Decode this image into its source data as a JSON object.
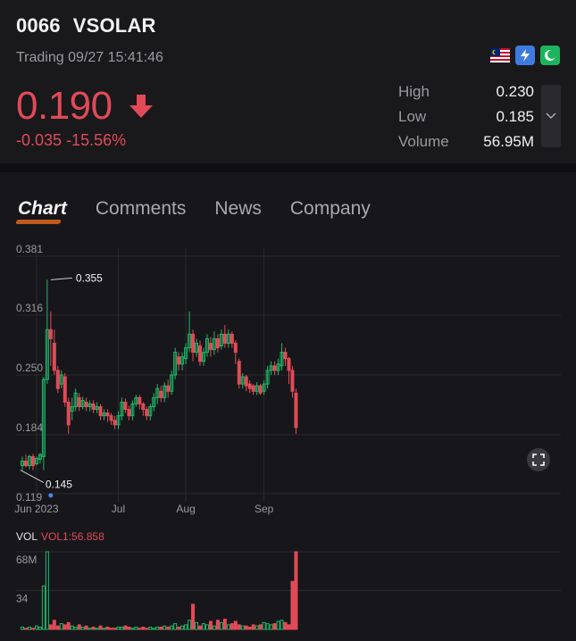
{
  "stock": {
    "code": "0066",
    "name": "VSOLAR"
  },
  "status": "Trading 09/27 15:41:46",
  "market_badges": [
    {
      "name": "malaysia-flag-icon",
      "color": "#c8102e"
    },
    {
      "name": "lightning-badge-icon",
      "color": "#3e7be0"
    },
    {
      "name": "shariah-crescent-icon",
      "color": "#1bb55c"
    }
  ],
  "price": {
    "last": "0.190",
    "change": "-0.035",
    "change_pct": "-15.56%",
    "direction": "down"
  },
  "stats": [
    {
      "label": "High",
      "value": "0.230"
    },
    {
      "label": "Low",
      "value": "0.185"
    },
    {
      "label": "Volume",
      "value": "56.95M"
    }
  ],
  "tabs": [
    {
      "label": "Chart",
      "active": true
    },
    {
      "label": "Comments",
      "active": false
    },
    {
      "label": "News",
      "active": false
    },
    {
      "label": "Company",
      "active": false
    }
  ],
  "colors": {
    "up": "#1fb86a",
    "down": "#e24a57",
    "grid": "#2a2a2e",
    "bg": "#17171b"
  },
  "volume": {
    "label": "VOL",
    "value_label": "VOL1:56.858"
  },
  "chart_data": {
    "type": "candlestick",
    "y_ticks": [
      "0.381",
      "0.316",
      "0.250",
      "0.184",
      "0.119"
    ],
    "ylim": [
      0.119,
      0.381
    ],
    "x_ticks": [
      {
        "label": "Jun 2023",
        "index": 4
      },
      {
        "label": "Jul",
        "index": 27
      },
      {
        "label": "Aug",
        "index": 46
      },
      {
        "label": "Sep",
        "index": 68
      }
    ],
    "annotations": [
      {
        "label": "0.355",
        "index": 8,
        "value": 0.355
      },
      {
        "label": "0.145",
        "index": 6,
        "value": 0.145
      }
    ],
    "candles": [
      [
        0.15,
        0.155,
        0.145,
        0.16
      ],
      [
        0.155,
        0.15,
        0.148,
        0.162
      ],
      [
        0.15,
        0.16,
        0.146,
        0.162
      ],
      [
        0.16,
        0.15,
        0.145,
        0.163
      ],
      [
        0.152,
        0.158,
        0.15,
        0.16
      ],
      [
        0.157,
        0.162,
        0.152,
        0.164
      ],
      [
        0.16,
        0.245,
        0.145,
        0.248
      ],
      [
        0.245,
        0.3,
        0.24,
        0.355
      ],
      [
        0.3,
        0.29,
        0.26,
        0.32
      ],
      [
        0.285,
        0.255,
        0.25,
        0.3
      ],
      [
        0.255,
        0.235,
        0.23,
        0.26
      ],
      [
        0.24,
        0.25,
        0.235,
        0.255
      ],
      [
        0.248,
        0.22,
        0.215,
        0.252
      ],
      [
        0.22,
        0.195,
        0.185,
        0.225
      ],
      [
        0.21,
        0.215,
        0.2,
        0.225
      ],
      [
        0.215,
        0.23,
        0.21,
        0.235
      ],
      [
        0.225,
        0.215,
        0.21,
        0.23
      ],
      [
        0.215,
        0.222,
        0.212,
        0.226
      ],
      [
        0.22,
        0.215,
        0.21,
        0.225
      ],
      [
        0.215,
        0.218,
        0.21,
        0.222
      ],
      [
        0.218,
        0.212,
        0.208,
        0.222
      ],
      [
        0.212,
        0.215,
        0.208,
        0.22
      ],
      [
        0.215,
        0.205,
        0.2,
        0.218
      ],
      [
        0.205,
        0.208,
        0.2,
        0.212
      ],
      [
        0.208,
        0.205,
        0.198,
        0.212
      ],
      [
        0.205,
        0.2,
        0.195,
        0.208
      ],
      [
        0.2,
        0.195,
        0.19,
        0.205
      ],
      [
        0.195,
        0.205,
        0.19,
        0.21
      ],
      [
        0.205,
        0.22,
        0.2,
        0.225
      ],
      [
        0.22,
        0.212,
        0.208,
        0.224
      ],
      [
        0.212,
        0.205,
        0.2,
        0.216
      ],
      [
        0.205,
        0.218,
        0.2,
        0.222
      ],
      [
        0.218,
        0.225,
        0.215,
        0.228
      ],
      [
        0.225,
        0.218,
        0.212,
        0.228
      ],
      [
        0.218,
        0.212,
        0.205,
        0.22
      ],
      [
        0.212,
        0.205,
        0.2,
        0.215
      ],
      [
        0.205,
        0.215,
        0.2,
        0.218
      ],
      [
        0.215,
        0.225,
        0.21,
        0.23
      ],
      [
        0.225,
        0.235,
        0.218,
        0.24
      ],
      [
        0.232,
        0.225,
        0.22,
        0.238
      ],
      [
        0.225,
        0.238,
        0.22,
        0.242
      ],
      [
        0.238,
        0.232,
        0.225,
        0.245
      ],
      [
        0.232,
        0.25,
        0.228,
        0.255
      ],
      [
        0.25,
        0.275,
        0.245,
        0.28
      ],
      [
        0.27,
        0.262,
        0.255,
        0.275
      ],
      [
        0.262,
        0.27,
        0.255,
        0.275
      ],
      [
        0.268,
        0.28,
        0.262,
        0.285
      ],
      [
        0.28,
        0.295,
        0.275,
        0.32
      ],
      [
        0.295,
        0.275,
        0.265,
        0.3
      ],
      [
        0.275,
        0.285,
        0.27,
        0.29
      ],
      [
        0.282,
        0.265,
        0.26,
        0.288
      ],
      [
        0.265,
        0.275,
        0.26,
        0.28
      ],
      [
        0.275,
        0.29,
        0.27,
        0.295
      ],
      [
        0.285,
        0.278,
        0.27,
        0.292
      ],
      [
        0.278,
        0.29,
        0.272,
        0.298
      ],
      [
        0.29,
        0.28,
        0.275,
        0.295
      ],
      [
        0.282,
        0.295,
        0.278,
        0.3
      ],
      [
        0.295,
        0.285,
        0.28,
        0.305
      ],
      [
        0.285,
        0.295,
        0.28,
        0.3
      ],
      [
        0.295,
        0.285,
        0.28,
        0.298
      ],
      [
        0.285,
        0.275,
        0.262,
        0.288
      ],
      [
        0.265,
        0.24,
        0.235,
        0.268
      ],
      [
        0.24,
        0.248,
        0.235,
        0.252
      ],
      [
        0.248,
        0.238,
        0.232,
        0.25
      ],
      [
        0.24,
        0.235,
        0.23,
        0.244
      ],
      [
        0.238,
        0.232,
        0.228,
        0.24
      ],
      [
        0.232,
        0.238,
        0.228,
        0.242
      ],
      [
        0.238,
        0.23,
        0.228,
        0.24
      ],
      [
        0.232,
        0.24,
        0.228,
        0.244
      ],
      [
        0.24,
        0.255,
        0.235,
        0.26
      ],
      [
        0.255,
        0.26,
        0.25,
        0.265
      ],
      [
        0.26,
        0.255,
        0.25,
        0.265
      ],
      [
        0.255,
        0.262,
        0.25,
        0.268
      ],
      [
        0.26,
        0.275,
        0.255,
        0.285
      ],
      [
        0.275,
        0.268,
        0.26,
        0.28
      ],
      [
        0.268,
        0.255,
        0.24,
        0.27
      ],
      [
        0.255,
        0.232,
        0.225,
        0.26
      ],
      [
        0.23,
        0.192,
        0.185,
        0.235
      ]
    ],
    "volumes": [
      2,
      1,
      2,
      1,
      3,
      2,
      38,
      68,
      4,
      8,
      3,
      5,
      4,
      6,
      3,
      2,
      4,
      2,
      3,
      1,
      2,
      1,
      3,
      1,
      2,
      1,
      1,
      2,
      2,
      3,
      2,
      1,
      2,
      1,
      2,
      1,
      2,
      1,
      2,
      2,
      3,
      2,
      3,
      5,
      2,
      3,
      4,
      8,
      22,
      6,
      3,
      5,
      4,
      7,
      3,
      8,
      6,
      9,
      4,
      5,
      7,
      4,
      3,
      3,
      2,
      4,
      3,
      4,
      6,
      5,
      4,
      5,
      7,
      8,
      6,
      4,
      42,
      68
    ],
    "volume_ticks": [
      "68M",
      "34"
    ]
  }
}
